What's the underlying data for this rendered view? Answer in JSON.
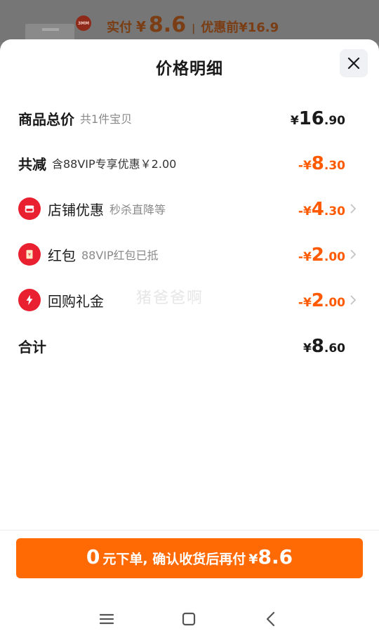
{
  "top": {
    "badge": "3MM",
    "paid_label": "实付",
    "yen": "¥",
    "paid_value": "8.6",
    "separator": "|",
    "original_label": "优惠前",
    "original_value": "¥16.9"
  },
  "sheet": {
    "title": "价格明细",
    "watermark": "猪爸爸啊"
  },
  "rows": [
    {
      "label": "商品总价",
      "sub": "共1件宝贝",
      "sign": "",
      "sym": "¥",
      "int": "16",
      "dec": ".90"
    },
    {
      "label": "共减",
      "sub": "含88VIP专享优惠￥2.00",
      "sign": "-",
      "sym": "¥",
      "int": "8",
      "dec": ".30"
    },
    {
      "label": "店铺优惠",
      "sub": "秒杀直降等",
      "sign": "-",
      "sym": "¥",
      "int": "4",
      "dec": ".30",
      "icon": "shop-icon"
    },
    {
      "label": "红包",
      "sub": "88VIP红包已抵",
      "sign": "-",
      "sym": "¥",
      "int": "2",
      "dec": ".00",
      "icon": "red-envelope-icon"
    },
    {
      "label": "回购礼金",
      "sub": "",
      "sign": "-",
      "sym": "¥",
      "int": "2",
      "dec": ".00",
      "icon": "lightning-icon"
    },
    {
      "label": "合计",
      "sub": "",
      "sign": "",
      "sym": "¥",
      "int": "8",
      "dec": ".60"
    }
  ],
  "pay_button": {
    "zero": "0",
    "text": "元下单, 确认收货后再付",
    "yen": "¥",
    "value": "8.6"
  },
  "colors": {
    "accent": "#ff6a05",
    "discount": "#ff5a00",
    "icon_red": "#e8202f"
  }
}
